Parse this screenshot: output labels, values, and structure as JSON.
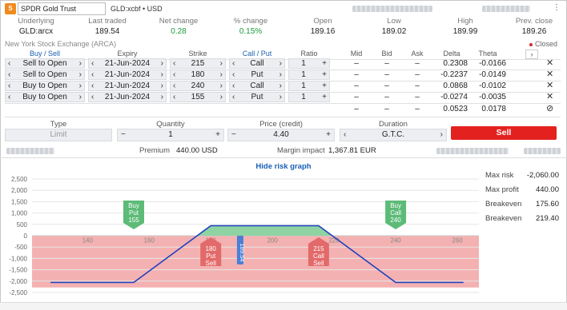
{
  "instrument": {
    "name": "SPDR Gold Trust",
    "info": "GLD:xcbf • USD",
    "app_icon": "saxo-icon"
  },
  "quote": {
    "headers": [
      "Underlying",
      "Last traded",
      "Net change",
      "% change",
      "Open",
      "Low",
      "High",
      "Prev. close"
    ],
    "values": [
      "GLD:arcx",
      "189.54",
      "0.28",
      "0.15%",
      "189.16",
      "189.02",
      "189.99",
      "189.26"
    ]
  },
  "exchange": "New York Stock Exchange (ARCA)",
  "market_status": "Closed",
  "legs_header": {
    "buy_sell": "Buy / Sell",
    "expiry": "Expiry",
    "strike": "Strike",
    "call_put": "Call / Put",
    "ratio": "Ratio",
    "mid": "Mid",
    "bid": "Bid",
    "ask": "Ask",
    "delta": "Delta",
    "theta": "Theta"
  },
  "legs": [
    {
      "side": "Sell to Open",
      "expiry": "21-Jun-2024",
      "strike": "215",
      "type": "Call",
      "ratio": "1",
      "mid": "–",
      "bid": "–",
      "ask": "–",
      "delta": "0.2308",
      "theta": "-0.0166"
    },
    {
      "side": "Sell to Open",
      "expiry": "21-Jun-2024",
      "strike": "180",
      "type": "Put",
      "ratio": "1",
      "mid": "–",
      "bid": "–",
      "ask": "–",
      "delta": "-0.2237",
      "theta": "-0.0149"
    },
    {
      "side": "Buy to Open",
      "expiry": "21-Jun-2024",
      "strike": "240",
      "type": "Call",
      "ratio": "1",
      "mid": "–",
      "bid": "–",
      "ask": "–",
      "delta": "0.0868",
      "theta": "-0.0102"
    },
    {
      "side": "Buy to Open",
      "expiry": "21-Jun-2024",
      "strike": "155",
      "type": "Put",
      "ratio": "1",
      "mid": "–",
      "bid": "–",
      "ask": "–",
      "delta": "-0.0274",
      "theta": "-0.0035"
    }
  ],
  "totals": {
    "mid": "–",
    "bid": "–",
    "ask": "–",
    "delta": "0.0523",
    "theta": "0.0178"
  },
  "order": {
    "type_label": "Type",
    "type_value": "Limit",
    "quantity_label": "Quantity",
    "quantity_value": "1",
    "price_label": "Price (credit)",
    "price_value": "4.40",
    "duration_label": "Duration",
    "duration_value": "G.T.C.",
    "submit_label": "Sell"
  },
  "summary": {
    "premium_label": "Premium",
    "premium_value": "440.00 USD",
    "margin_label": "Margin impact",
    "margin_value": "1,367.81 EUR"
  },
  "risk_toggle": "Hide risk graph",
  "risk": [
    {
      "label": "Max risk",
      "value": "-2,060.00"
    },
    {
      "label": "Max profit",
      "value": "440.00"
    },
    {
      "label": "Breakeven",
      "value": "175.60"
    },
    {
      "label": "Breakeven",
      "value": "219.40"
    }
  ],
  "colors": {
    "accent": "#1a5fb4",
    "sell": "#e32220",
    "profit_fill": "#8fd3a3",
    "loss_fill": "#f2a3a3",
    "payoff_line": "#1c3fbf",
    "buy_marker": "#5dbb78",
    "sell_marker": "#e36a6a"
  },
  "chart_data": {
    "type": "line",
    "title": "",
    "xlabel": "",
    "ylabel": "",
    "xlim": [
      122,
      267
    ],
    "ylim": [
      -2500,
      2500
    ],
    "x_ticks": [
      140,
      160,
      180,
      200,
      220,
      240,
      260
    ],
    "y_ticks": [
      2500,
      2000,
      1500,
      1000,
      500,
      0,
      -500,
      -1000,
      -1500,
      -2000,
      -2500
    ],
    "series": [
      {
        "x": [
          128,
          155,
          175.6,
          180,
          215,
          219.4,
          240,
          262
        ],
        "y": [
          -2060,
          -2060,
          0,
          440,
          440,
          0,
          -2060,
          -2060
        ]
      }
    ],
    "current_price": "189.54",
    "markers": [
      {
        "action": "Buy",
        "type": "Put",
        "strike": "155",
        "position": "above"
      },
      {
        "action": "Buy",
        "type": "Call",
        "strike": "240",
        "position": "above"
      },
      {
        "action": "Sell",
        "type": "Put",
        "strike": "180",
        "position": "below"
      },
      {
        "action": "Sell",
        "type": "Call",
        "strike": "215",
        "position": "below"
      }
    ]
  }
}
